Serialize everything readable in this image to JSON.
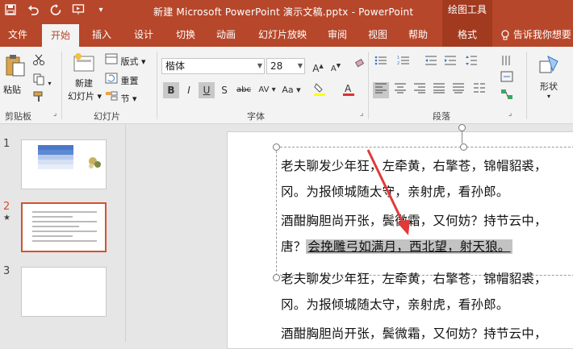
{
  "titlebar": {
    "title": "新建 Microsoft PowerPoint 演示文稿.pptx  -  PowerPoint",
    "context_tab": "绘图工具",
    "qat": [
      "save-icon",
      "undo-icon",
      "redo-icon",
      "presenter-icon",
      "customize-icon"
    ]
  },
  "tabs": [
    {
      "label": "文件"
    },
    {
      "label": "开始"
    },
    {
      "label": "插入"
    },
    {
      "label": "设计"
    },
    {
      "label": "切换"
    },
    {
      "label": "动画"
    },
    {
      "label": "幻灯片放映"
    },
    {
      "label": "审阅"
    },
    {
      "label": "视图"
    },
    {
      "label": "帮助"
    },
    {
      "label": "格式"
    }
  ],
  "tellme": "告诉我你想要",
  "ribbon": {
    "clipboard": {
      "paste": "粘贴",
      "label": "剪贴板"
    },
    "slides": {
      "new_slide_1": "新建",
      "new_slide_2": "幻灯片",
      "layout": "版式",
      "reset": "重置",
      "section": "节",
      "label": "幻灯片"
    },
    "font": {
      "name": "楷体",
      "size": "28",
      "label": "字体",
      "bold": "B",
      "italic": "I",
      "underline": "U",
      "strike": "S",
      "shadow": "abc",
      "spacing": "AV",
      "case": "Aa"
    },
    "paragraph": {
      "label": "段落"
    },
    "drawing": {
      "shape": "形状"
    }
  },
  "thumbs": [
    {
      "num": "1"
    },
    {
      "num": "2",
      "marker": "★"
    },
    {
      "num": "3"
    }
  ],
  "slide": {
    "lines": [
      "老夫聊发少年狂，左牵黄，右擎苍，锦帽貂裘，",
      "冈。为报倾城随太守，亲射虎，看孙郎。",
      "酒酣胸胆尚开张，鬓微霜，又何妨？持节云中，",
      "唐？",
      "会挽雕弓如满月，西北望，射天狼。",
      "老夫聊发少年狂，左牵黄，右擎苍，锦帽貂裘，",
      "冈。为报倾城随太守，亲射虎，看孙郎。",
      "酒酣胸胆尚开张，鬓微霜，又何妨？持节云中，"
    ]
  },
  "colors": {
    "brand": "#b7472a",
    "accent": "#d35230",
    "arrow": "#e03a3a"
  }
}
